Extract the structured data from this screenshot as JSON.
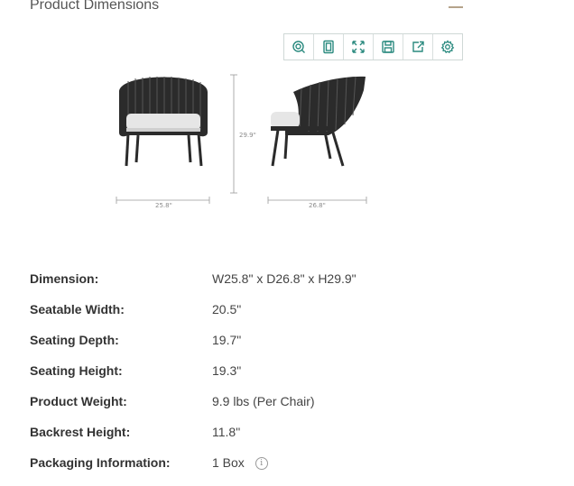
{
  "section": {
    "title": "Product Dimensions"
  },
  "toolbar": {
    "icons": [
      "zoom-icon",
      "fit-icon",
      "expand-icon",
      "save-icon",
      "share-icon",
      "settings-icon"
    ],
    "accent": "#2a8a7f"
  },
  "figure": {
    "width_label": "25.8\"",
    "height_label": "29.9\"",
    "depth_label": "26.8\""
  },
  "specs": [
    {
      "label": "Dimension:",
      "value": "W25.8\" x D26.8\" x H29.9\""
    },
    {
      "label": "Seatable Width:",
      "value": "20.5\""
    },
    {
      "label": "Seating Depth:",
      "value": "19.7\""
    },
    {
      "label": "Seating Height:",
      "value": "19.3\""
    },
    {
      "label": "Product Weight:",
      "value": "9.9 lbs (Per Chair)"
    },
    {
      "label": "Backrest Height:",
      "value": "11.8\""
    },
    {
      "label": "Packaging Information:",
      "value": "1 Box"
    }
  ]
}
